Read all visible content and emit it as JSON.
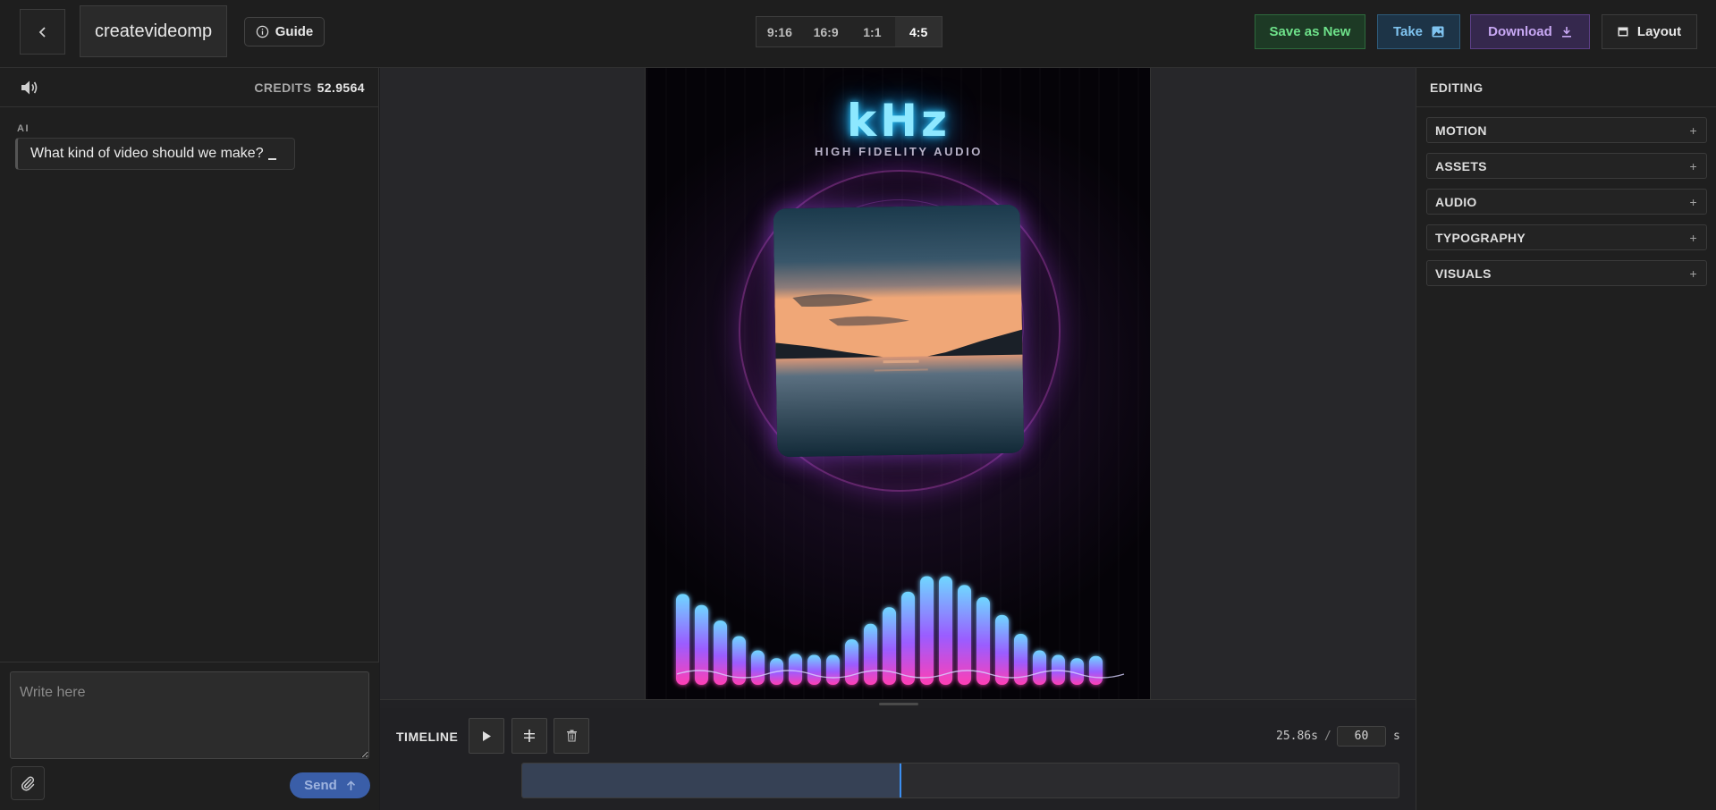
{
  "header": {
    "project_name": "createvideomp",
    "guide_label": "Guide",
    "aspect_ratios": [
      "9:16",
      "16:9",
      "1:1",
      "4:5"
    ],
    "active_ratio": "4:5",
    "save_as_new_label": "Save as New",
    "take_label": "Take",
    "download_label": "Download",
    "layout_label": "Layout"
  },
  "chat": {
    "credits_label": "CREDITS",
    "credits_value": "52.9564",
    "ai_label": "AI",
    "ai_message": "What kind of video should we make?",
    "input_placeholder": "Write here",
    "send_label": "Send"
  },
  "preview": {
    "logo_text": "kHz",
    "logo_subtitle": "HIGH FIDELITY AUDIO",
    "equalizer_levels": [
      0.82,
      0.72,
      0.58,
      0.44,
      0.31,
      0.24,
      0.28,
      0.27,
      0.27,
      0.41,
      0.55,
      0.7,
      0.84,
      0.98,
      0.98,
      0.9,
      0.79,
      0.63,
      0.46,
      0.31,
      0.27,
      0.24,
      0.26
    ]
  },
  "timeline": {
    "label": "TIMELINE",
    "current_time": "25.86s",
    "separator": "/",
    "duration": "60",
    "unit": "s",
    "progress_fraction": 0.431
  },
  "editing": {
    "title": "EDITING",
    "sections": [
      "MOTION",
      "ASSETS",
      "AUDIO",
      "TYPOGRAPHY",
      "VISUALS"
    ]
  },
  "colors": {
    "save_green": "#6ee28a",
    "take_blue": "#7fc4f0",
    "download_purple": "#c8a8f4",
    "send_blue": "#3a5ea8",
    "playhead": "#3b8ef0",
    "logo_cyan": "#8de8ff"
  }
}
